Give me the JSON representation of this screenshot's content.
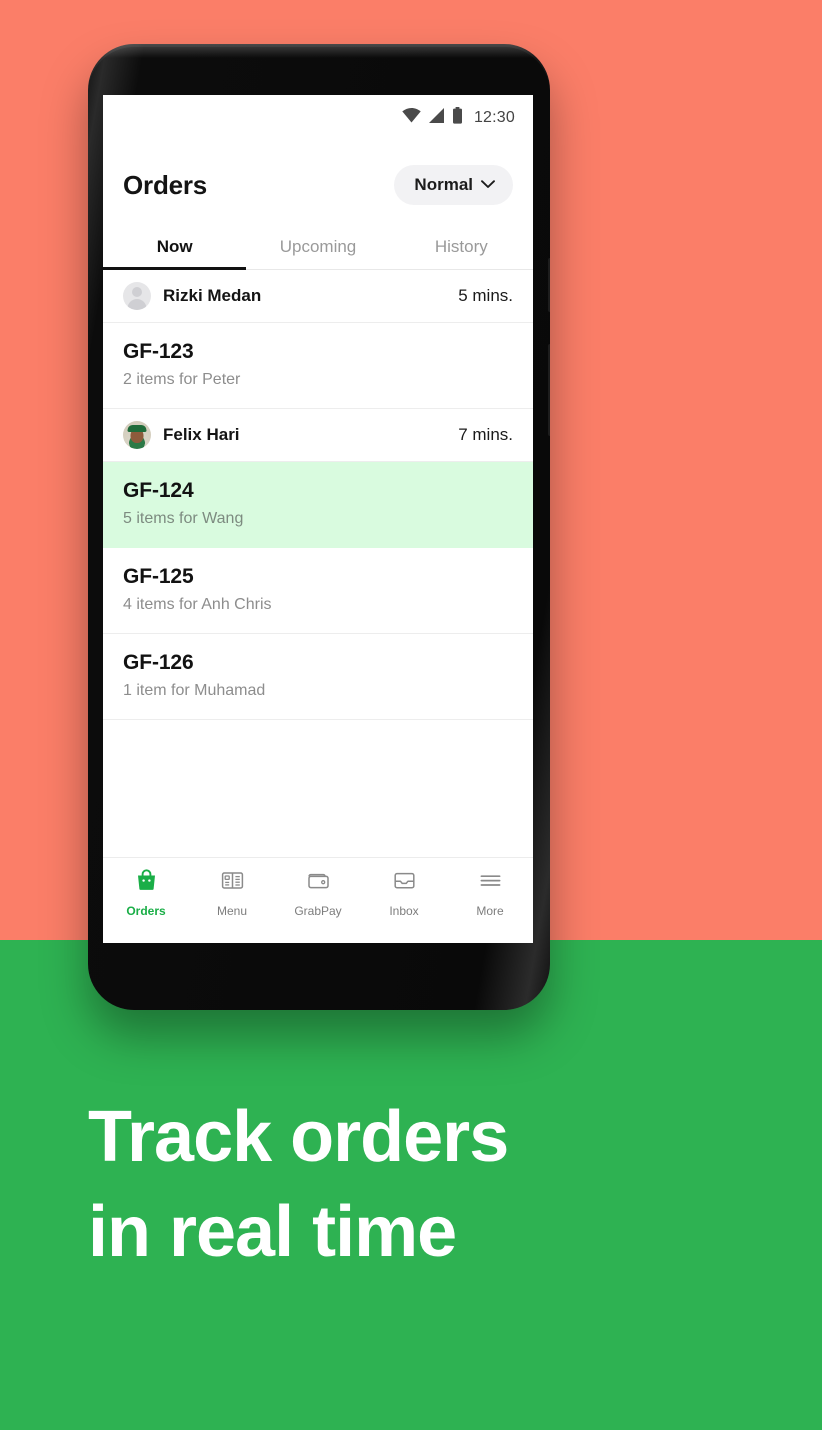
{
  "theme": {
    "bg_top": "#fb7e68",
    "bg_bottom": "#2eb252",
    "accent_green": "#1aae47",
    "highlight_row": "#d9fbdf"
  },
  "status_bar": {
    "time": "12:30",
    "icons": [
      "wifi-icon",
      "cellular-signal-icon",
      "battery-icon"
    ]
  },
  "header": {
    "title": "Orders",
    "filter": {
      "label": "Normal",
      "icon": "chevron-down-icon"
    }
  },
  "tabs": [
    {
      "label": "Now",
      "active": true
    },
    {
      "label": "Upcoming",
      "active": false
    },
    {
      "label": "History",
      "active": false
    }
  ],
  "list": {
    "customers": [
      {
        "name": "Rizki Medan",
        "eta": "5 mins.",
        "avatar": "placeholder-avatar"
      },
      {
        "name": "Felix Hari",
        "eta": "7 mins.",
        "avatar": "photo-avatar"
      }
    ],
    "orders": [
      {
        "code": "GF-123",
        "sub": "2 items for Peter",
        "highlight": false
      },
      {
        "code": "GF-124",
        "sub": "5 items for Wang",
        "highlight": true
      },
      {
        "code": "GF-125",
        "sub": "4 items for Anh Chris",
        "highlight": false
      },
      {
        "code": "GF-126",
        "sub": "1 item for Muhamad",
        "highlight": false
      }
    ]
  },
  "bottom_nav": [
    {
      "label": "Orders",
      "icon": "shopping-bag-icon",
      "active": true
    },
    {
      "label": "Menu",
      "icon": "menu-book-icon",
      "active": false
    },
    {
      "label": "GrabPay",
      "icon": "wallet-icon",
      "active": false
    },
    {
      "label": "Inbox",
      "icon": "inbox-tray-icon",
      "active": false
    },
    {
      "label": "More",
      "icon": "hamburger-icon",
      "active": false
    }
  ],
  "headline": {
    "line1": "Track orders",
    "line2": "in real time"
  }
}
